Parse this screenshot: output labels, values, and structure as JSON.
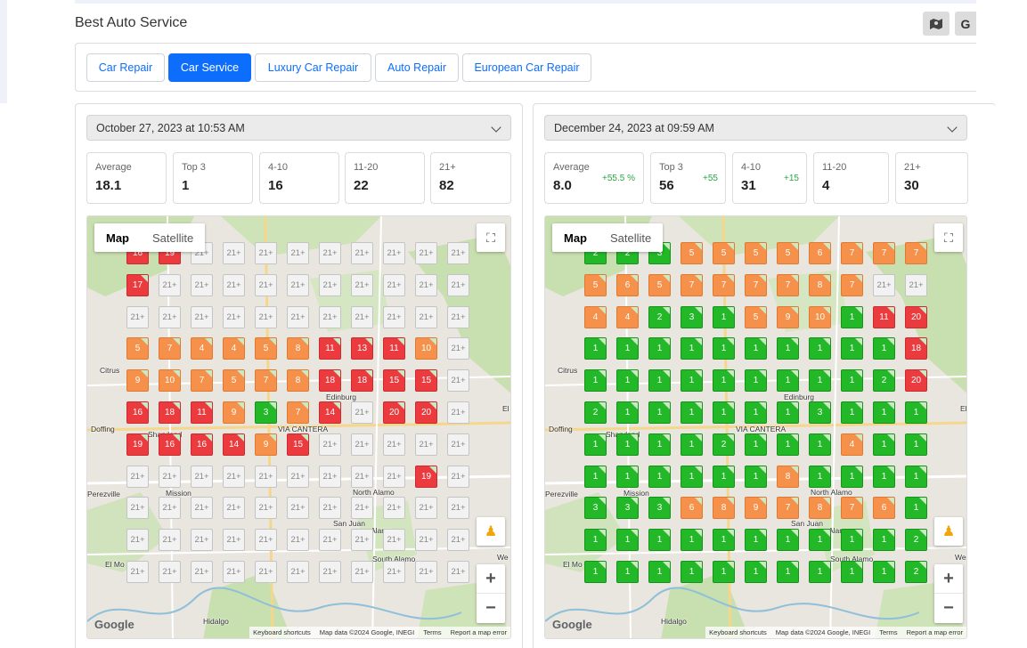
{
  "header": {
    "title": "Best Auto Service",
    "map_button_icon": "map-icon",
    "google_button": "G"
  },
  "tabs": [
    {
      "label": "Car Repair",
      "active": false
    },
    {
      "label": "Car Service",
      "active": true
    },
    {
      "label": "Luxury Car Repair",
      "active": false
    },
    {
      "label": "Auto Repair",
      "active": false
    },
    {
      "label": "European Car Repair",
      "active": false
    }
  ],
  "colors": {
    "accent": "#0d6efd",
    "green": "#22b827",
    "orange": "#f5914a",
    "red": "#eb3b3f",
    "none": "#f2f2f2",
    "delta": "#28a745"
  },
  "panels": [
    {
      "date": "October 27, 2023 at 10:53 AM",
      "stats": [
        {
          "label": "Average",
          "value": "18.1",
          "delta": ""
        },
        {
          "label": "Top 3",
          "value": "1",
          "delta": ""
        },
        {
          "label": "4-10",
          "value": "16",
          "delta": ""
        },
        {
          "label": "11-20",
          "value": "22",
          "delta": ""
        },
        {
          "label": "21+",
          "value": "82",
          "delta": ""
        }
      ],
      "grid": [
        [
          "16",
          "19",
          "21+",
          "21+",
          "21+",
          "21+",
          "21+",
          "21+",
          "21+",
          "21+",
          "21+"
        ],
        [
          "17",
          "21+",
          "21+",
          "21+",
          "21+",
          "21+",
          "21+",
          "21+",
          "21+",
          "21+",
          "21+"
        ],
        [
          "21+",
          "21+",
          "21+",
          "21+",
          "21+",
          "21+",
          "21+",
          "21+",
          "21+",
          "21+",
          "21+"
        ],
        [
          "5",
          "7",
          "4",
          "4",
          "5",
          "8",
          "11",
          "13",
          "11",
          "10",
          "21+"
        ],
        [
          "9",
          "10",
          "7",
          "5",
          "7",
          "8",
          "18",
          "18",
          "15",
          "15",
          "21+"
        ],
        [
          "16",
          "18",
          "11",
          "9",
          "3",
          "7",
          "14",
          "21+",
          "20",
          "20",
          "21+"
        ],
        [
          "19",
          "16",
          "16",
          "14",
          "9",
          "15",
          "21+",
          "21+",
          "21+",
          "21+",
          "21+"
        ],
        [
          "21+",
          "21+",
          "21+",
          "21+",
          "21+",
          "21+",
          "21+",
          "21+",
          "21+",
          "19",
          "21+"
        ],
        [
          "21+",
          "21+",
          "21+",
          "21+",
          "21+",
          "21+",
          "21+",
          "21+",
          "21+",
          "21+",
          "21+"
        ],
        [
          "21+",
          "21+",
          "21+",
          "21+",
          "21+",
          "21+",
          "21+",
          "21+",
          "21+",
          "21+",
          "21+"
        ],
        [
          "21+",
          "21+",
          "21+",
          "21+",
          "21+",
          "21+",
          "21+",
          "21+",
          "21+",
          "21+",
          "21+"
        ]
      ]
    },
    {
      "date": "December 24, 2023 at 09:59 AM",
      "stats": [
        {
          "label": "Average",
          "value": "8.0",
          "delta": "+55.5 %"
        },
        {
          "label": "Top 3",
          "value": "56",
          "delta": "+55"
        },
        {
          "label": "4-10",
          "value": "31",
          "delta": "+15"
        },
        {
          "label": "11-20",
          "value": "4",
          "delta": ""
        },
        {
          "label": "21+",
          "value": "30",
          "delta": ""
        }
      ],
      "grid": [
        [
          "2",
          "2",
          "3",
          "5",
          "5",
          "5",
          "5",
          "6",
          "7",
          "7",
          "7"
        ],
        [
          "5",
          "6",
          "5",
          "7",
          "7",
          "7",
          "7",
          "8",
          "7",
          "21+",
          "21+"
        ],
        [
          "4",
          "4",
          "2",
          "3",
          "1",
          "5",
          "9",
          "10",
          "1",
          "11",
          "20"
        ],
        [
          "1",
          "1",
          "1",
          "1",
          "1",
          "1",
          "1",
          "1",
          "1",
          "1",
          "18"
        ],
        [
          "1",
          "1",
          "1",
          "1",
          "1",
          "1",
          "1",
          "1",
          "1",
          "2",
          "20"
        ],
        [
          "2",
          "1",
          "1",
          "1",
          "1",
          "1",
          "1",
          "3",
          "1",
          "1",
          "1"
        ],
        [
          "1",
          "1",
          "1",
          "1",
          "2",
          "1",
          "1",
          "1",
          "4",
          "1",
          "1"
        ],
        [
          "1",
          "1",
          "1",
          "1",
          "1",
          "1",
          "8",
          "1",
          "1",
          "1",
          "1"
        ],
        [
          "3",
          "3",
          "3",
          "6",
          "8",
          "9",
          "7",
          "8",
          "7",
          "6",
          "1"
        ],
        [
          "1",
          "1",
          "1",
          "1",
          "1",
          "1",
          "1",
          "1",
          "1",
          "1",
          "2"
        ],
        [
          "1",
          "1",
          "1",
          "1",
          "1",
          "1",
          "1",
          "1",
          "1",
          "1",
          "2"
        ]
      ]
    }
  ],
  "map": {
    "type_map": "Map",
    "type_satellite": "Satellite",
    "google": "Google",
    "attribution": [
      "Keyboard shortcuts",
      "Map data ©2024 Google, INEGI",
      "Terms",
      "Report a map error"
    ],
    "places": [
      {
        "name": "Citrus",
        "id": "citrus"
      },
      {
        "name": "Edinburg",
        "id": "edinburg"
      },
      {
        "name": "Doffing",
        "id": "doffing"
      },
      {
        "name": "Sharyland",
        "id": "sharyland"
      },
      {
        "name": "VIA CANTERA",
        "id": "via-cantera"
      },
      {
        "name": "Perezville",
        "id": "perezville"
      },
      {
        "name": "Mission",
        "id": "mission"
      },
      {
        "name": "North Alamo",
        "id": "north-alamo"
      },
      {
        "name": "San Juan",
        "id": "san-juan"
      },
      {
        "name": "Alamo",
        "id": "alamo"
      },
      {
        "name": "South Alamo",
        "id": "south-alamo"
      },
      {
        "name": "El Mo",
        "id": "el-mo"
      },
      {
        "name": "Hidalgo",
        "id": "hidalgo"
      },
      {
        "name": "We",
        "id": "we"
      },
      {
        "name": "El",
        "id": "el"
      }
    ]
  }
}
